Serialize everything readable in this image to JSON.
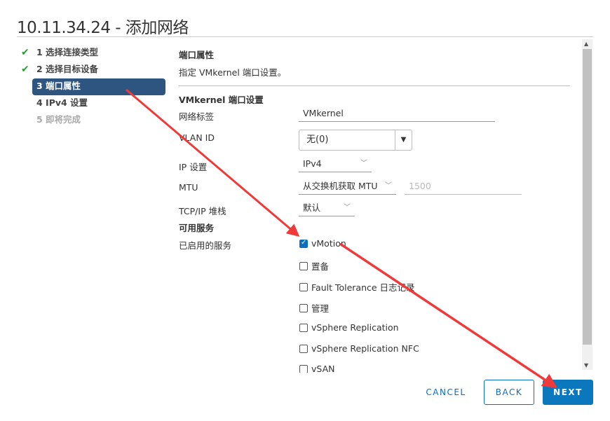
{
  "window": {
    "title": "10.11.34.24 - 添加网络"
  },
  "steps": [
    {
      "label": "1 选择连接类型",
      "state": "done"
    },
    {
      "label": "2 选择目标设备",
      "state": "done"
    },
    {
      "label": "3 端口属性",
      "state": "active"
    },
    {
      "label": "4 IPv4 设置",
      "state": "pending"
    },
    {
      "label": "5 即将完成",
      "state": "disabled"
    }
  ],
  "content": {
    "heading": "端口属性",
    "description": "指定 VMkernel 端口设置。",
    "section": "VMkernel 端口设置",
    "network_label": {
      "label": "网络标签",
      "value": "VMkernel"
    },
    "vlan": {
      "label": "VLAN ID",
      "value": "无(0)"
    },
    "ip": {
      "label": "IP 设置",
      "value": "IPv4"
    },
    "mtu": {
      "label": "MTU",
      "value": "从交换机获取 MTU",
      "placeholder": "1500"
    },
    "tcpip": {
      "label": "TCP/IP 堆栈",
      "value": "默认"
    },
    "services_heading": "可用服务",
    "enabled_label": "已启用的服务",
    "services": [
      {
        "label": "vMotion",
        "checked": true
      },
      {
        "label": "置备",
        "checked": false
      },
      {
        "label": "Fault Tolerance 日志记录",
        "checked": false
      },
      {
        "label": "管理",
        "checked": false
      },
      {
        "label": "vSphere Replication",
        "checked": false
      },
      {
        "label": "vSphere Replication NFC",
        "checked": false
      },
      {
        "label": "vSAN",
        "checked": false
      }
    ]
  },
  "footer": {
    "cancel": "CANCEL",
    "back": "BACK",
    "next": "NEXT"
  },
  "colors": {
    "accent": "#0b77bd",
    "active_step": "#2d5580",
    "check": "#2e9b3a",
    "annotation_arrow": "#f03a3a"
  }
}
